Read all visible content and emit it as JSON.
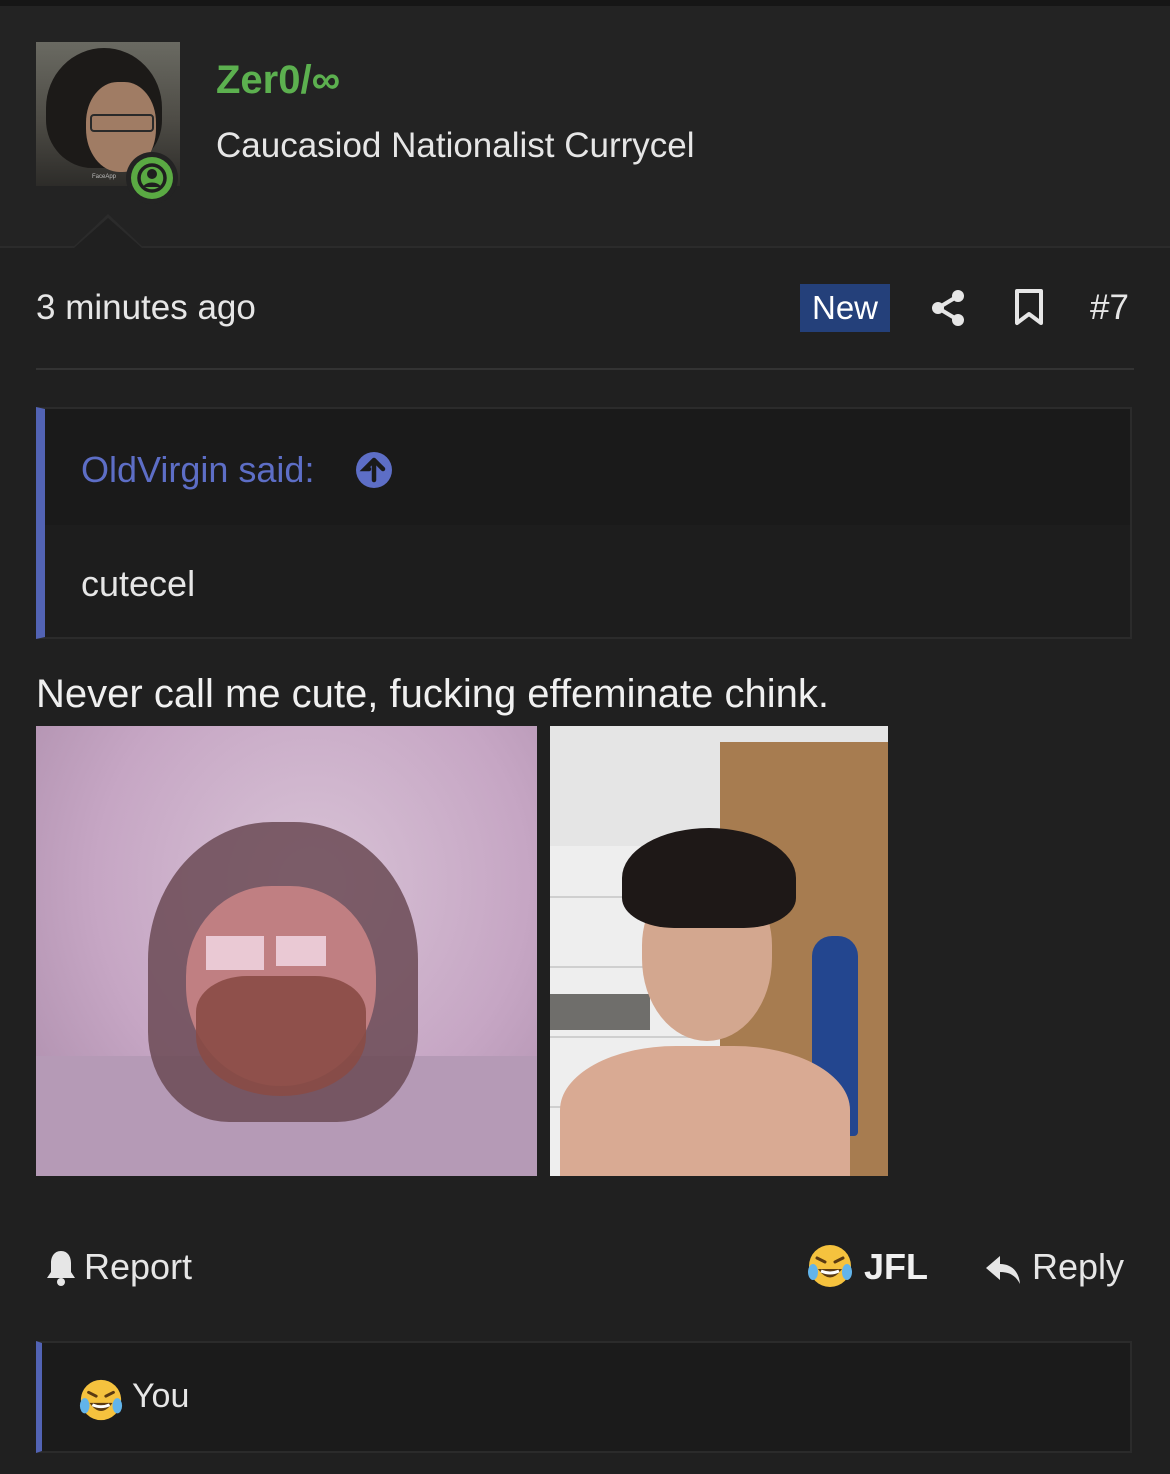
{
  "post": {
    "author": {
      "username": "Zer0/∞",
      "user_title": "Caucasiod Nationalist Currycel",
      "avatar_label": "FaceApp",
      "online": true
    },
    "meta": {
      "time": "3 minutes ago",
      "new_badge": "New",
      "post_number": "#7"
    },
    "quote": {
      "author_line": "OldVirgin said:",
      "body": "cutecel"
    },
    "message": "Never call me cute, fucking effeminate chink.",
    "attachments": [
      {
        "kind": "photo",
        "description_icon": "photo-1"
      },
      {
        "kind": "photo",
        "description_icon": "photo-2"
      }
    ],
    "actions": {
      "report": "Report",
      "reaction": "JFL",
      "reply": "Reply"
    },
    "reactions_bar": {
      "who": "You"
    }
  },
  "colors": {
    "background": "#202020",
    "username": "#5cb04f",
    "accent": "#5263b4",
    "new_badge": "#24407a"
  }
}
